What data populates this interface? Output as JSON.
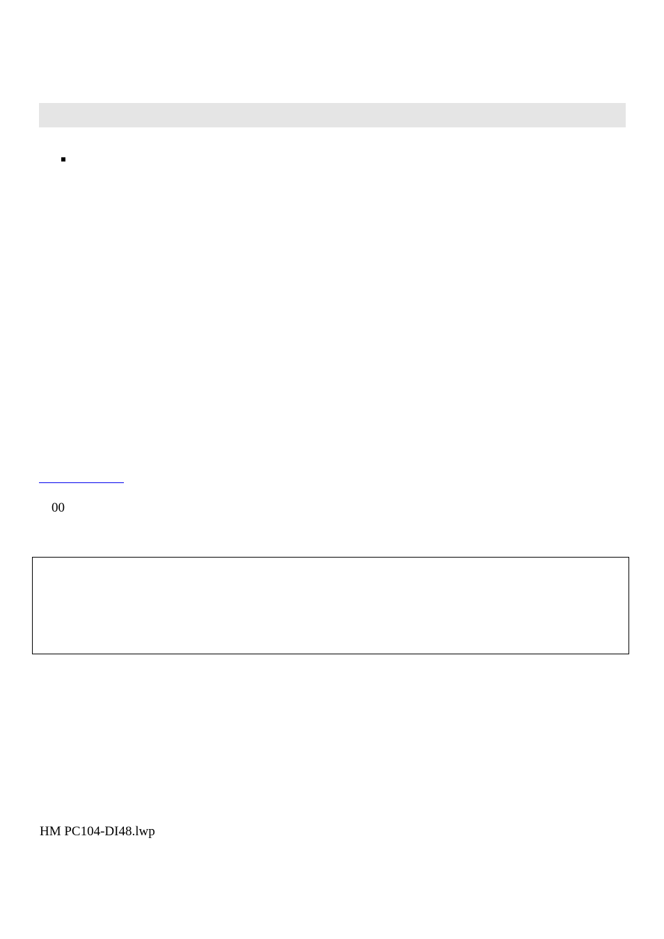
{
  "section_bar": "",
  "bullet_marker": "▪",
  "link_text": "",
  "zeros_text": "00",
  "box_content": "",
  "footer": "HM PC104-DI48.lwp"
}
